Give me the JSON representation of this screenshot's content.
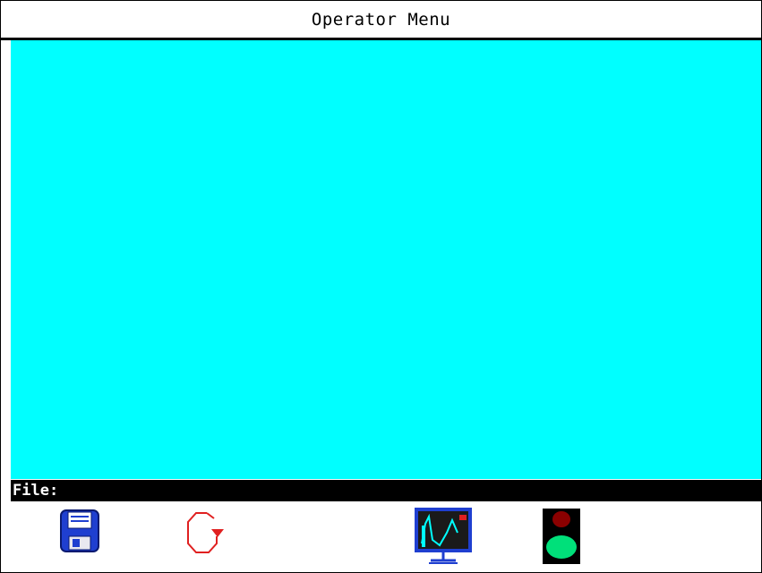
{
  "window": {
    "title": "Operator Menu"
  },
  "file_bar": {
    "label": "File:",
    "value": ""
  },
  "toolbar": {
    "buttons": [
      {
        "name": "save-button",
        "icon": "floppy-disk-icon"
      },
      {
        "name": "refresh-button",
        "icon": "rotate-arrow-icon"
      },
      {
        "name": "trend-monitor-button",
        "icon": "monitor-chart-icon"
      },
      {
        "name": "traffic-light-button",
        "icon": "traffic-light-icon"
      }
    ]
  },
  "colors": {
    "main_area": "#00ffff",
    "file_bar": "#000000",
    "floppy": "#1f3fd0",
    "refresh_arrow": "#e02020",
    "light_red": "#8b0000",
    "light_green": "#00e07a"
  }
}
